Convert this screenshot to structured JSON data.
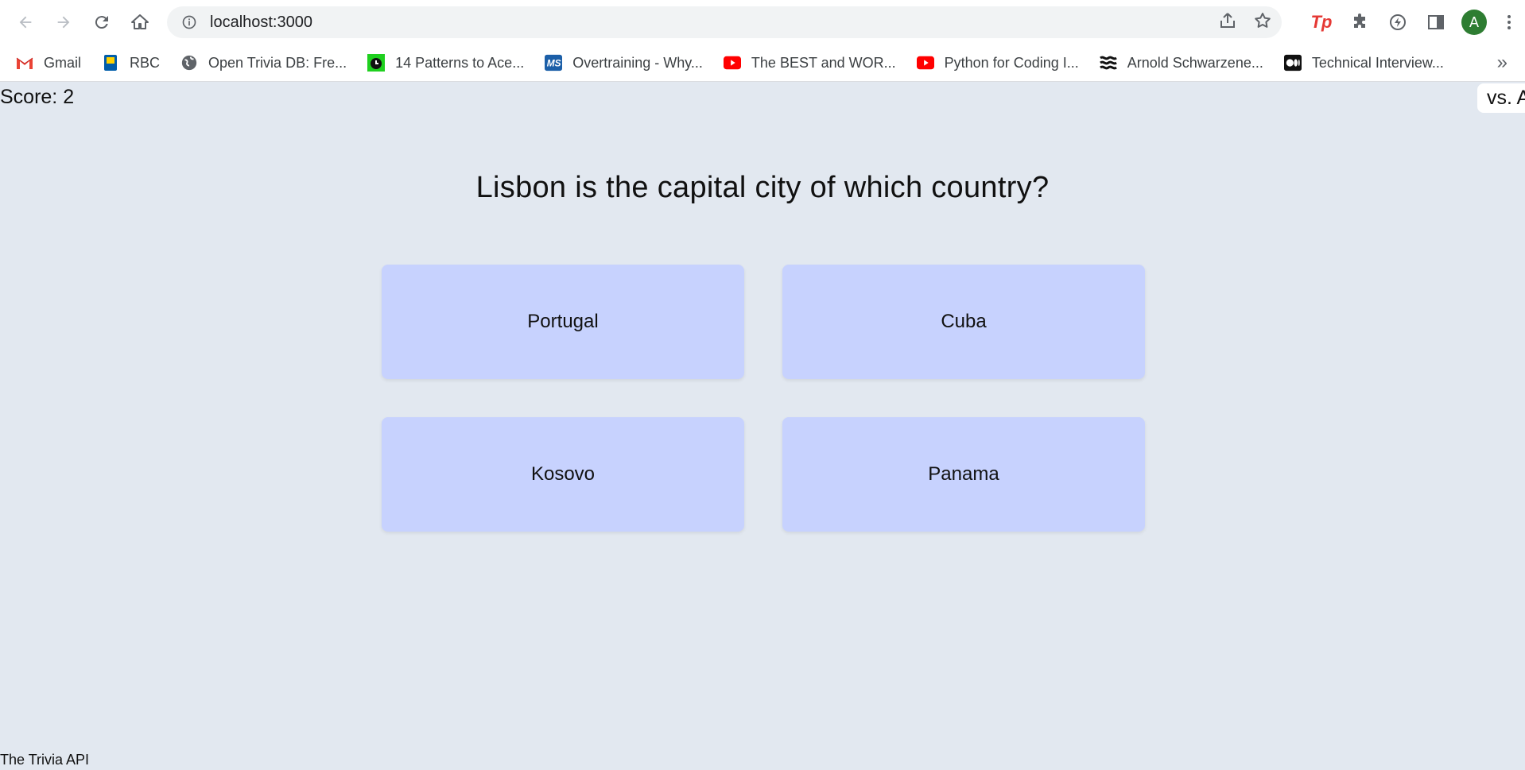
{
  "browser": {
    "url": "localhost:3000",
    "bookmarks": [
      {
        "label": "Gmail",
        "icon": "gmail-icon"
      },
      {
        "label": "RBC",
        "icon": "rbc-icon"
      },
      {
        "label": "Open Trivia DB: Fre...",
        "icon": "globe-icon"
      },
      {
        "label": "14 Patterns to Ace...",
        "icon": "clock-icon"
      },
      {
        "label": "Overtraining - Why...",
        "icon": "ms-icon"
      },
      {
        "label": "The BEST and WOR...",
        "icon": "youtube-icon"
      },
      {
        "label": "Python for Coding I...",
        "icon": "youtube-icon"
      },
      {
        "label": "Arnold Schwarzene...",
        "icon": "waves-icon"
      },
      {
        "label": "Technical Interview...",
        "icon": "medium-icon"
      }
    ],
    "more_label": "»",
    "profile_initial": "A",
    "colors": {
      "youtube": "#ff0000",
      "avatar": "#2e7d32",
      "tp": "#e53935"
    }
  },
  "app": {
    "score": "Score: 2",
    "mode": "vs. AI",
    "question": "Lisbon is the capital city of which country?",
    "answers": [
      "Portugal",
      "Cuba",
      "Kosovo",
      "Panama"
    ],
    "footer": "The Trivia API",
    "colors": {
      "background": "#e2e8f0",
      "answer_bg": "#c7d2fe"
    }
  }
}
